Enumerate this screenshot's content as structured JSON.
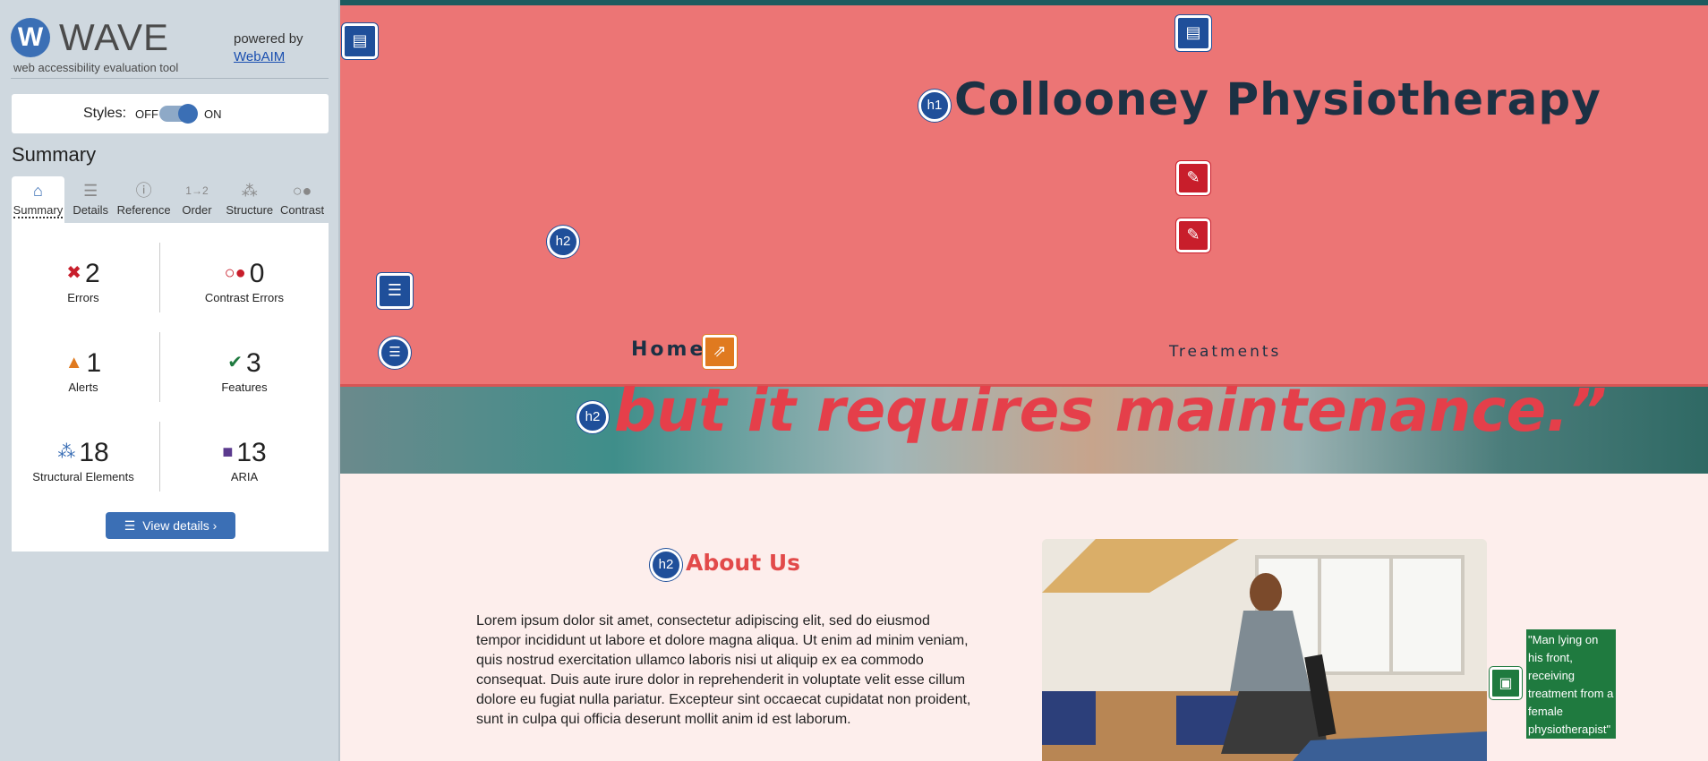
{
  "wave": {
    "logo_letter": "W",
    "logo_name": "WAVE",
    "tagline": "web accessibility evaluation tool",
    "powered_by": "powered by",
    "webaim_link": "WebAIM",
    "styles_label": "Styles:",
    "styles_off": "OFF",
    "styles_on": "ON",
    "summary_title": "Summary",
    "tabs": [
      {
        "label": "Summary",
        "icon": "home-icon"
      },
      {
        "label": "Details",
        "icon": "list-icon"
      },
      {
        "label": "Reference",
        "icon": "info-icon"
      },
      {
        "label": "Order",
        "icon": "order-icon"
      },
      {
        "label": "Structure",
        "icon": "structure-icon"
      },
      {
        "label": "Contrast",
        "icon": "contrast-icon"
      }
    ],
    "stats": {
      "errors": {
        "value": "2",
        "label": "Errors"
      },
      "contrast_errors": {
        "value": "0",
        "label": "Contrast Errors"
      },
      "alerts": {
        "value": "1",
        "label": "Alerts"
      },
      "features": {
        "value": "3",
        "label": "Features"
      },
      "structural": {
        "value": "18",
        "label": "Structural Elements"
      },
      "aria": {
        "value": "13",
        "label": "ARIA"
      }
    },
    "view_details": "View details ›"
  },
  "site": {
    "title": "Collooney Physiotherapy",
    "nav": {
      "home": "Home",
      "treatments": "Treatments"
    },
    "hero_quote": "but it requires maintenance.”",
    "about_title": "About Us",
    "about_text": "Lorem ipsum dolor sit amet, consectetur adipiscing elit, sed do eiusmod tempor incididunt ut labore et dolore magna aliqua. Ut enim ad minim veniam, quis nostrud exercitation ullamco laboris nisi ut aliquip ex ea commodo consequat. Duis aute irure dolor in reprehenderit in voluptate velit esse cillum dolore eu fugiat nulla pariatur. Excepteur sint occaecat cupidatat non proident, sunt in culpa qui officia deserunt mollit anim id est laborum.",
    "image_alt": "\"Man lying on his front, receiving treatment from a female physiotherapist\""
  },
  "badges": {
    "h1": "h1",
    "h2": "h2"
  },
  "colors": {
    "header_bg": "#ec7575",
    "accent_red": "#e24a4a",
    "wave_blue": "#3b6fb5",
    "sidebar_bg": "#cfd8df"
  }
}
